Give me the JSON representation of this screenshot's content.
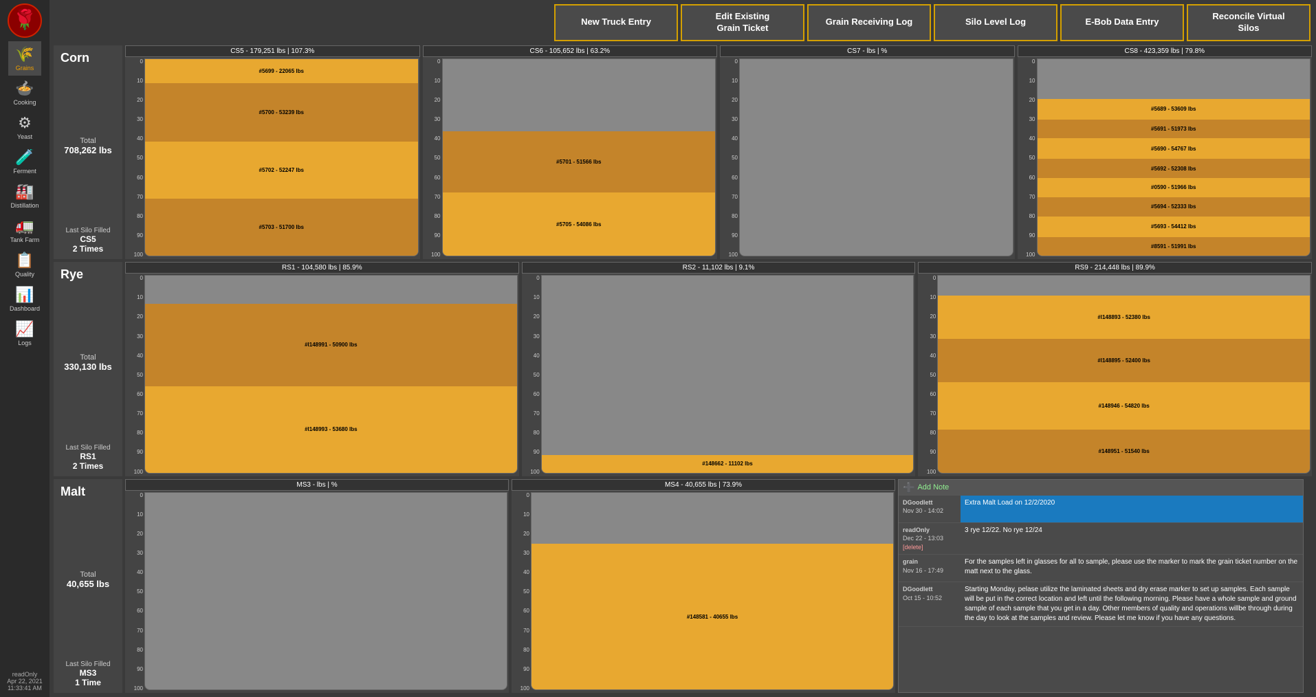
{
  "sidebar": {
    "logo_color": "#cc2200",
    "items": [
      {
        "id": "grains",
        "label": "Grains",
        "icon": "🌾",
        "active": true
      },
      {
        "id": "cooking",
        "label": "Cooking",
        "icon": "🍲",
        "active": false
      },
      {
        "id": "yeast",
        "label": "Yeast",
        "icon": "⚙",
        "active": false
      },
      {
        "id": "ferment",
        "label": "Ferment",
        "icon": "🧪",
        "active": false
      },
      {
        "id": "distillation",
        "label": "Distillation",
        "icon": "🏭",
        "active": false
      },
      {
        "id": "tank_farm",
        "label": "Tank Farm",
        "icon": "🚛",
        "active": false
      },
      {
        "id": "quality",
        "label": "Quality",
        "icon": "📋",
        "active": false
      },
      {
        "id": "dashboard",
        "label": "Dashboard",
        "icon": "📊",
        "active": false
      },
      {
        "id": "logs",
        "label": "Logs",
        "icon": "📈",
        "active": false
      }
    ],
    "user": "readOnly",
    "date": "Apr 22, 2021",
    "time": "11:33:41 AM"
  },
  "buttons": {
    "new_truck": "New Truck Entry",
    "edit_grain": "Edit Existing\nGrain Ticket",
    "grain_log": "Grain Receiving Log",
    "silo_log": "Silo Level Log",
    "ebob": "E-Bob Data Entry",
    "reconcile": "Reconcile Virtual\nSilos"
  },
  "corn": {
    "title": "Corn",
    "total_label": "Total",
    "total": "708,262 lbs",
    "last_silo_label": "Last Silo Filled",
    "last_silo": "CS5",
    "last_times": "2 Times",
    "silos": [
      {
        "header": "CS5 - 179,251 lbs | 107.3%",
        "fill_pct": 107.3,
        "segments": [
          {
            "label": "#5703 - 51700 lbs",
            "pct": 33,
            "color": "#c4842a"
          },
          {
            "label": "#5702 - 52247 lbs",
            "pct": 33,
            "color": "#e8a830"
          },
          {
            "label": "#5700 - 53239 lbs",
            "pct": 34,
            "color": "#c4842a"
          },
          {
            "label": "#5699 - 22065 lbs",
            "pct": 14,
            "color": "#e8a830"
          }
        ],
        "y_labels": [
          "100",
          "90",
          "80",
          "70",
          "60",
          "50",
          "40",
          "30",
          "20",
          "10",
          "0"
        ]
      },
      {
        "header": "CS6 - 105,652 lbs | 63.2%",
        "fill_pct": 63.2,
        "segments": [
          {
            "label": "#5705 - 54086 lbs",
            "pct": 51,
            "color": "#e8a830"
          },
          {
            "label": "#5701 - 51566 lbs",
            "pct": 49,
            "color": "#c4842a"
          }
        ],
        "y_labels": [
          "100",
          "90",
          "80",
          "70",
          "60",
          "50",
          "40",
          "30",
          "20",
          "10",
          "0"
        ]
      },
      {
        "header": "CS7 - lbs | %",
        "fill_pct": 0,
        "segments": [],
        "y_labels": [
          "100",
          "90",
          "80",
          "70",
          "60",
          "50",
          "40",
          "30",
          "20",
          "10",
          "0"
        ]
      },
      {
        "header": "CS8 - 423,359 lbs | 79.8%",
        "fill_pct": 79.8,
        "segments": [
          {
            "label": "#8591 - 51991 lbs",
            "pct": 12,
            "color": "#c4842a"
          },
          {
            "label": "#5693 - 54412 lbs",
            "pct": 13,
            "color": "#e8a830"
          },
          {
            "label": "#5694 - 52333 lbs",
            "pct": 12,
            "color": "#c4842a"
          },
          {
            "label": "#0590 - 51966 lbs",
            "pct": 12,
            "color": "#e8a830"
          },
          {
            "label": "#5692 - 52308 lbs",
            "pct": 12,
            "color": "#c4842a"
          },
          {
            "label": "#5690 - 54767 lbs",
            "pct": 13,
            "color": "#e8a830"
          },
          {
            "label": "#5691 - 51973 lbs",
            "pct": 12,
            "color": "#c4842a"
          },
          {
            "label": "#5689 - 53609 lbs",
            "pct": 13,
            "color": "#e8a830"
          }
        ],
        "y_labels": [
          "100",
          "90",
          "80",
          "70",
          "60",
          "50",
          "40",
          "30",
          "20",
          "10",
          "0"
        ]
      }
    ]
  },
  "rye": {
    "title": "Rye",
    "total_label": "Total",
    "total": "330,130 lbs",
    "last_silo_label": "Last Silo Filled",
    "last_silo": "RS1",
    "last_times": "2 Times",
    "silos": [
      {
        "header": "RS1 - 104,580 lbs | 85.9%",
        "fill_pct": 85.9,
        "segments": [
          {
            "label": "#l148993 - 53680 lbs",
            "pct": 51,
            "color": "#e8a830"
          },
          {
            "label": "#l148991 - 50900 lbs",
            "pct": 49,
            "color": "#c4842a"
          }
        ],
        "y_labels": [
          "100",
          "90",
          "80",
          "70",
          "60",
          "50",
          "40",
          "30",
          "20",
          "10",
          "0"
        ]
      },
      {
        "header": "RS2 - 11,102 lbs | 9.1%",
        "fill_pct": 9.1,
        "segments": [
          {
            "label": "#148662 - 11102 lbs",
            "pct": 100,
            "color": "#e8a830"
          }
        ],
        "y_labels": [
          "100",
          "90",
          "80",
          "70",
          "60",
          "50",
          "40",
          "30",
          "20",
          "10",
          "0"
        ]
      },
      {
        "header": "RS9 - 214,448 lbs | 89.9%",
        "fill_pct": 89.9,
        "segments": [
          {
            "label": "#148951 - 51540 lbs",
            "pct": 24,
            "color": "#c4842a"
          },
          {
            "label": "#148946 - 54820 lbs",
            "pct": 26,
            "color": "#e8a830"
          },
          {
            "label": "#l148895 - 52400 lbs",
            "pct": 24,
            "color": "#c4842a"
          },
          {
            "label": "#l148893 - 52380 lbs",
            "pct": 24,
            "color": "#e8a830"
          }
        ],
        "y_labels": [
          "100",
          "90",
          "80",
          "70",
          "60",
          "50",
          "40",
          "30",
          "20",
          "10",
          "0"
        ]
      }
    ]
  },
  "malt": {
    "title": "Malt",
    "total_label": "Total",
    "total": "40,655 lbs",
    "last_silo_label": "Last Silo Filled",
    "last_silo": "MS3",
    "last_times": "1 Time",
    "silos": [
      {
        "header": "MS3 - lbs | %",
        "fill_pct": 0,
        "segments": [],
        "y_labels": [
          "100",
          "90",
          "80",
          "70",
          "60",
          "50",
          "40",
          "30",
          "20",
          "10",
          "0"
        ]
      },
      {
        "header": "MS4 - 40,655 lbs | 73.9%",
        "fill_pct": 73.9,
        "segments": [
          {
            "label": "#148581 - 40655 lbs",
            "pct": 100,
            "color": "#e8a830"
          }
        ],
        "y_labels": [
          "100",
          "90",
          "80",
          "70",
          "60",
          "50",
          "40",
          "30",
          "20",
          "10",
          "0"
        ]
      }
    ]
  },
  "notes": {
    "add_label": "Add Note",
    "items": [
      {
        "user": "DGoodlett",
        "date": "Nov 30 - 14:02",
        "content": "Extra Malt Load on 12/2/2020",
        "highlighted": true,
        "deletable": false
      },
      {
        "user": "readOnly",
        "date": "Dec 22 - 13:03",
        "delete_label": "[delete]",
        "content": "3 rye 12/22. No rye 12/24",
        "highlighted": false,
        "deletable": true
      },
      {
        "user": "grain",
        "date": "Nov 16 - 17:49",
        "content": "For the samples left in glasses for all to sample, please use the marker to mark the grain ticket number on the matt next to the glass.",
        "highlighted": false,
        "deletable": false
      },
      {
        "user": "DGoodlett",
        "date": "Oct 15 - 10:52",
        "content": "Starting Monday, pelase utilize the laminated sheets and dry erase marker to set up samples. Each sample will be put in the correct location and left until the following morning. Please have a whole sample and ground sample of each sample that you get in a day. Other members of quality and operations willbe through during the day to look at the samples and review. Please let me know if you have any questions.",
        "highlighted": false,
        "deletable": false
      }
    ]
  }
}
